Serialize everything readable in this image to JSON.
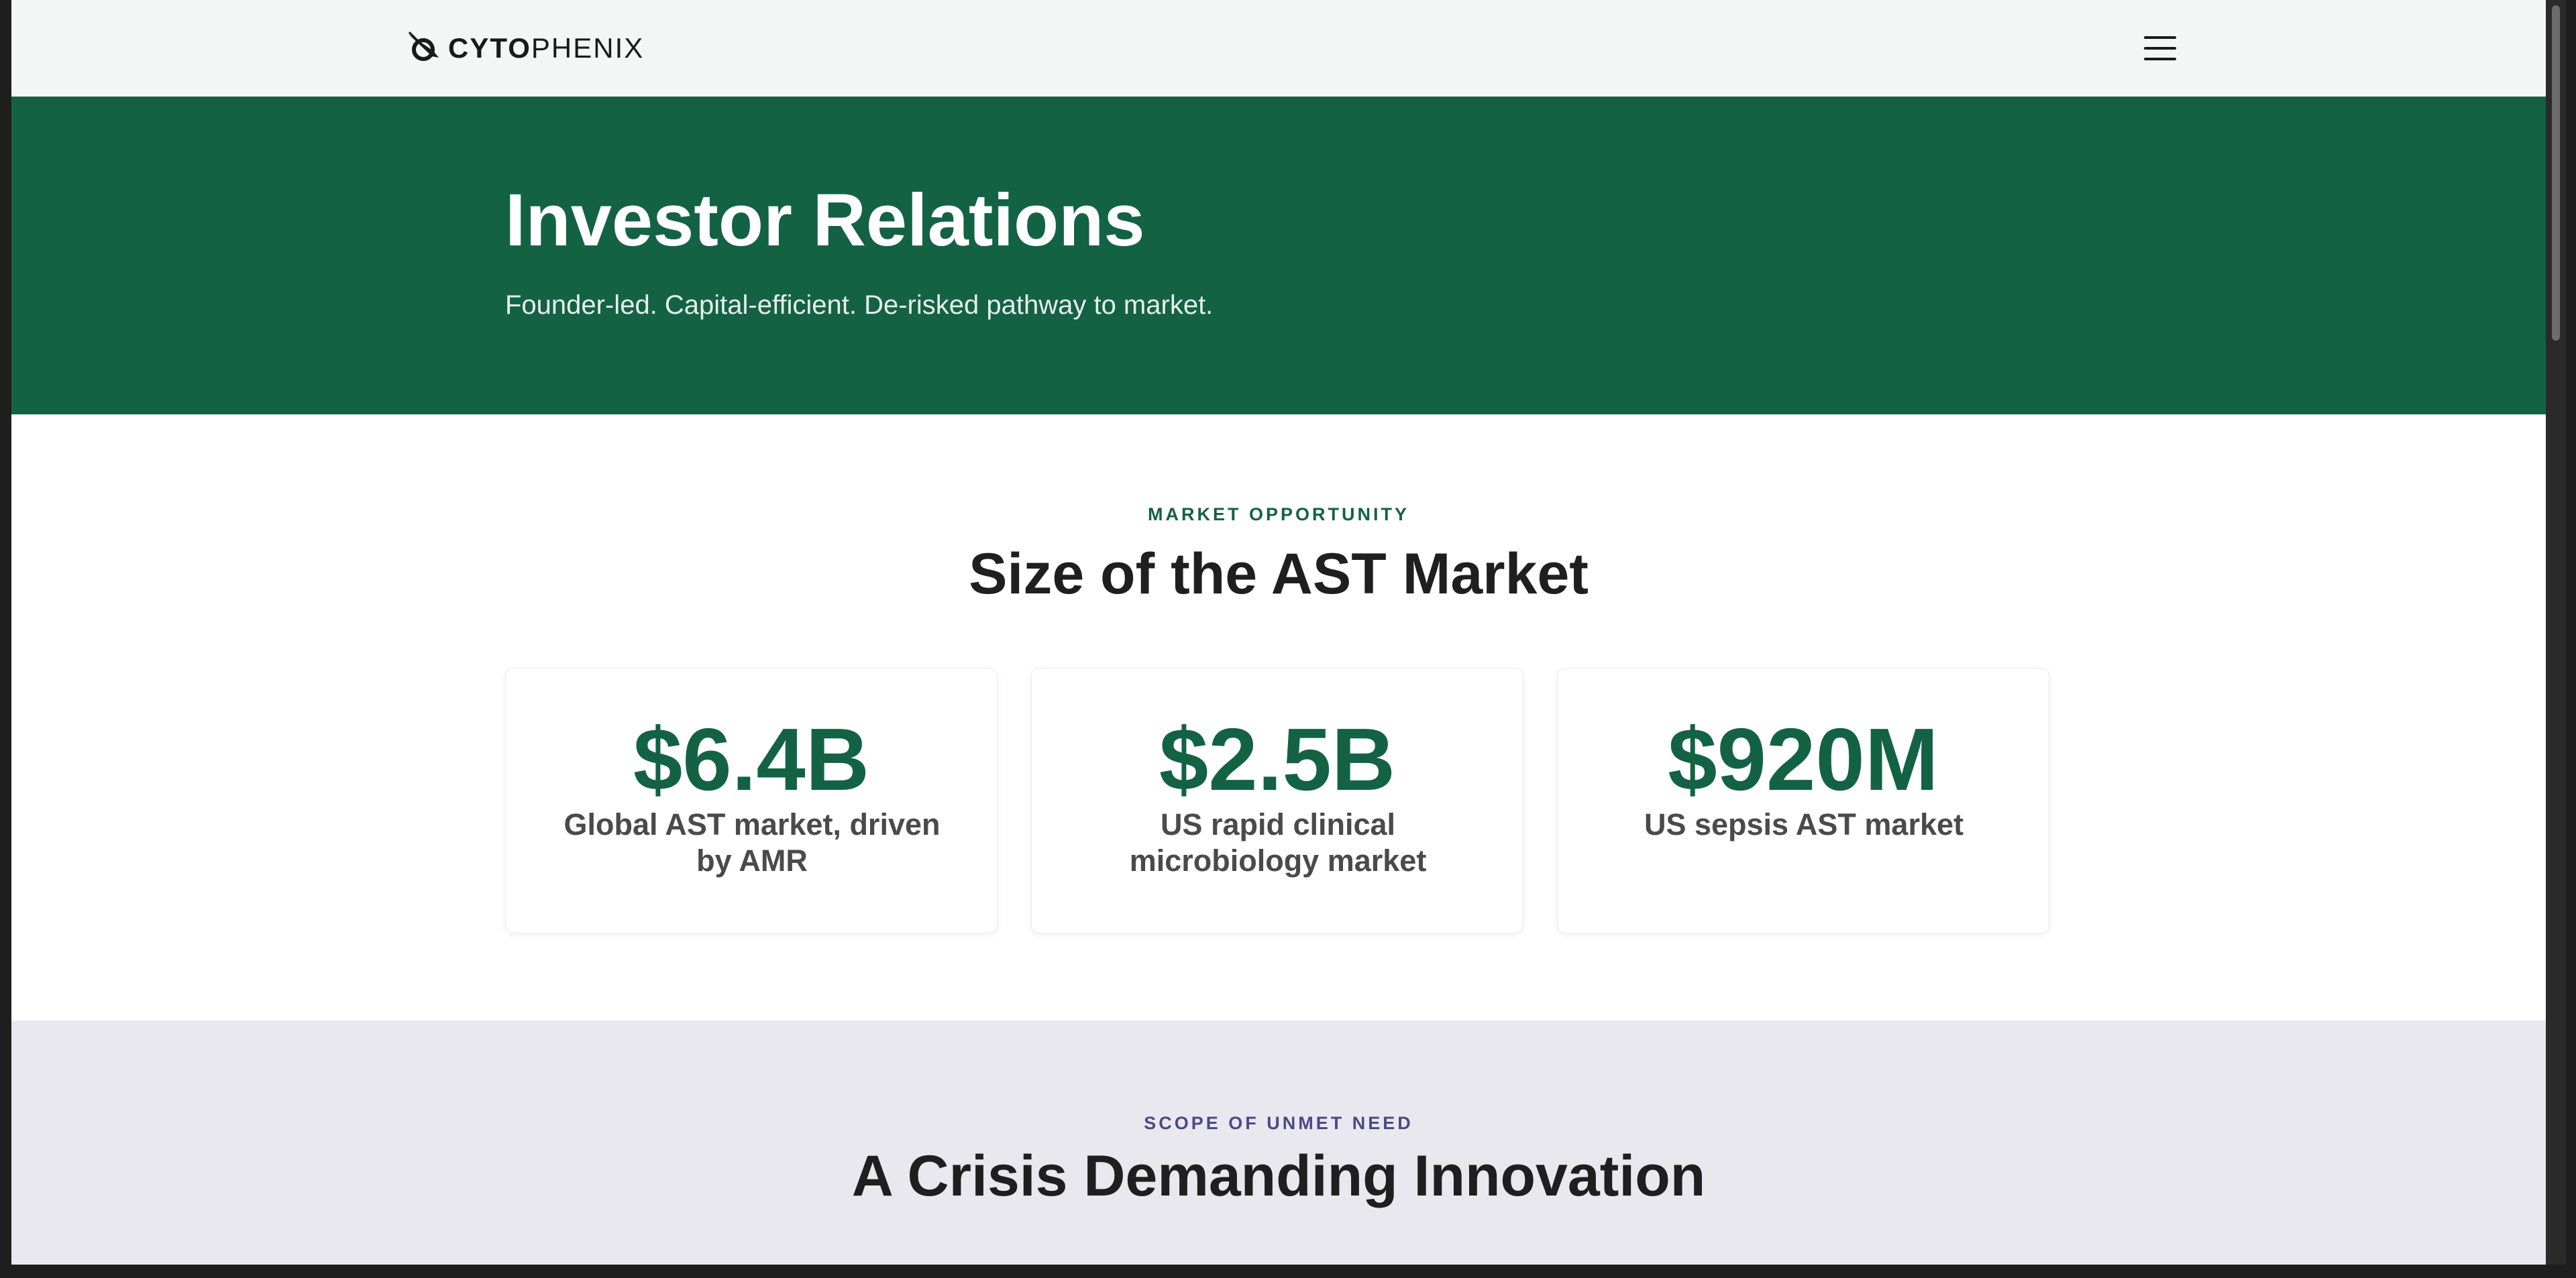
{
  "header": {
    "logo_bold": "CYTO",
    "logo_light": "PHENIX",
    "menu_icon": "hamburger-icon"
  },
  "hero": {
    "title": "Investor Relations",
    "subtitle": "Founder-led. Capital-efficient. De-risked pathway to market."
  },
  "market": {
    "eyebrow": "MARKET OPPORTUNITY",
    "title": "Size of the AST Market",
    "cards": [
      {
        "value": "$6.4B",
        "label": "Global AST market, driven by AMR"
      },
      {
        "value": "$2.5B",
        "label": "US rapid clinical microbiology market"
      },
      {
        "value": "$920M",
        "label": "US sepsis AST market"
      }
    ]
  },
  "need": {
    "eyebrow": "SCOPE OF UNMET NEED",
    "title": "A Crisis Demanding Innovation"
  },
  "colors": {
    "brand_green": "#136244",
    "need_eyebrow": "#4b4a86",
    "need_background": "#e9e8ee"
  }
}
